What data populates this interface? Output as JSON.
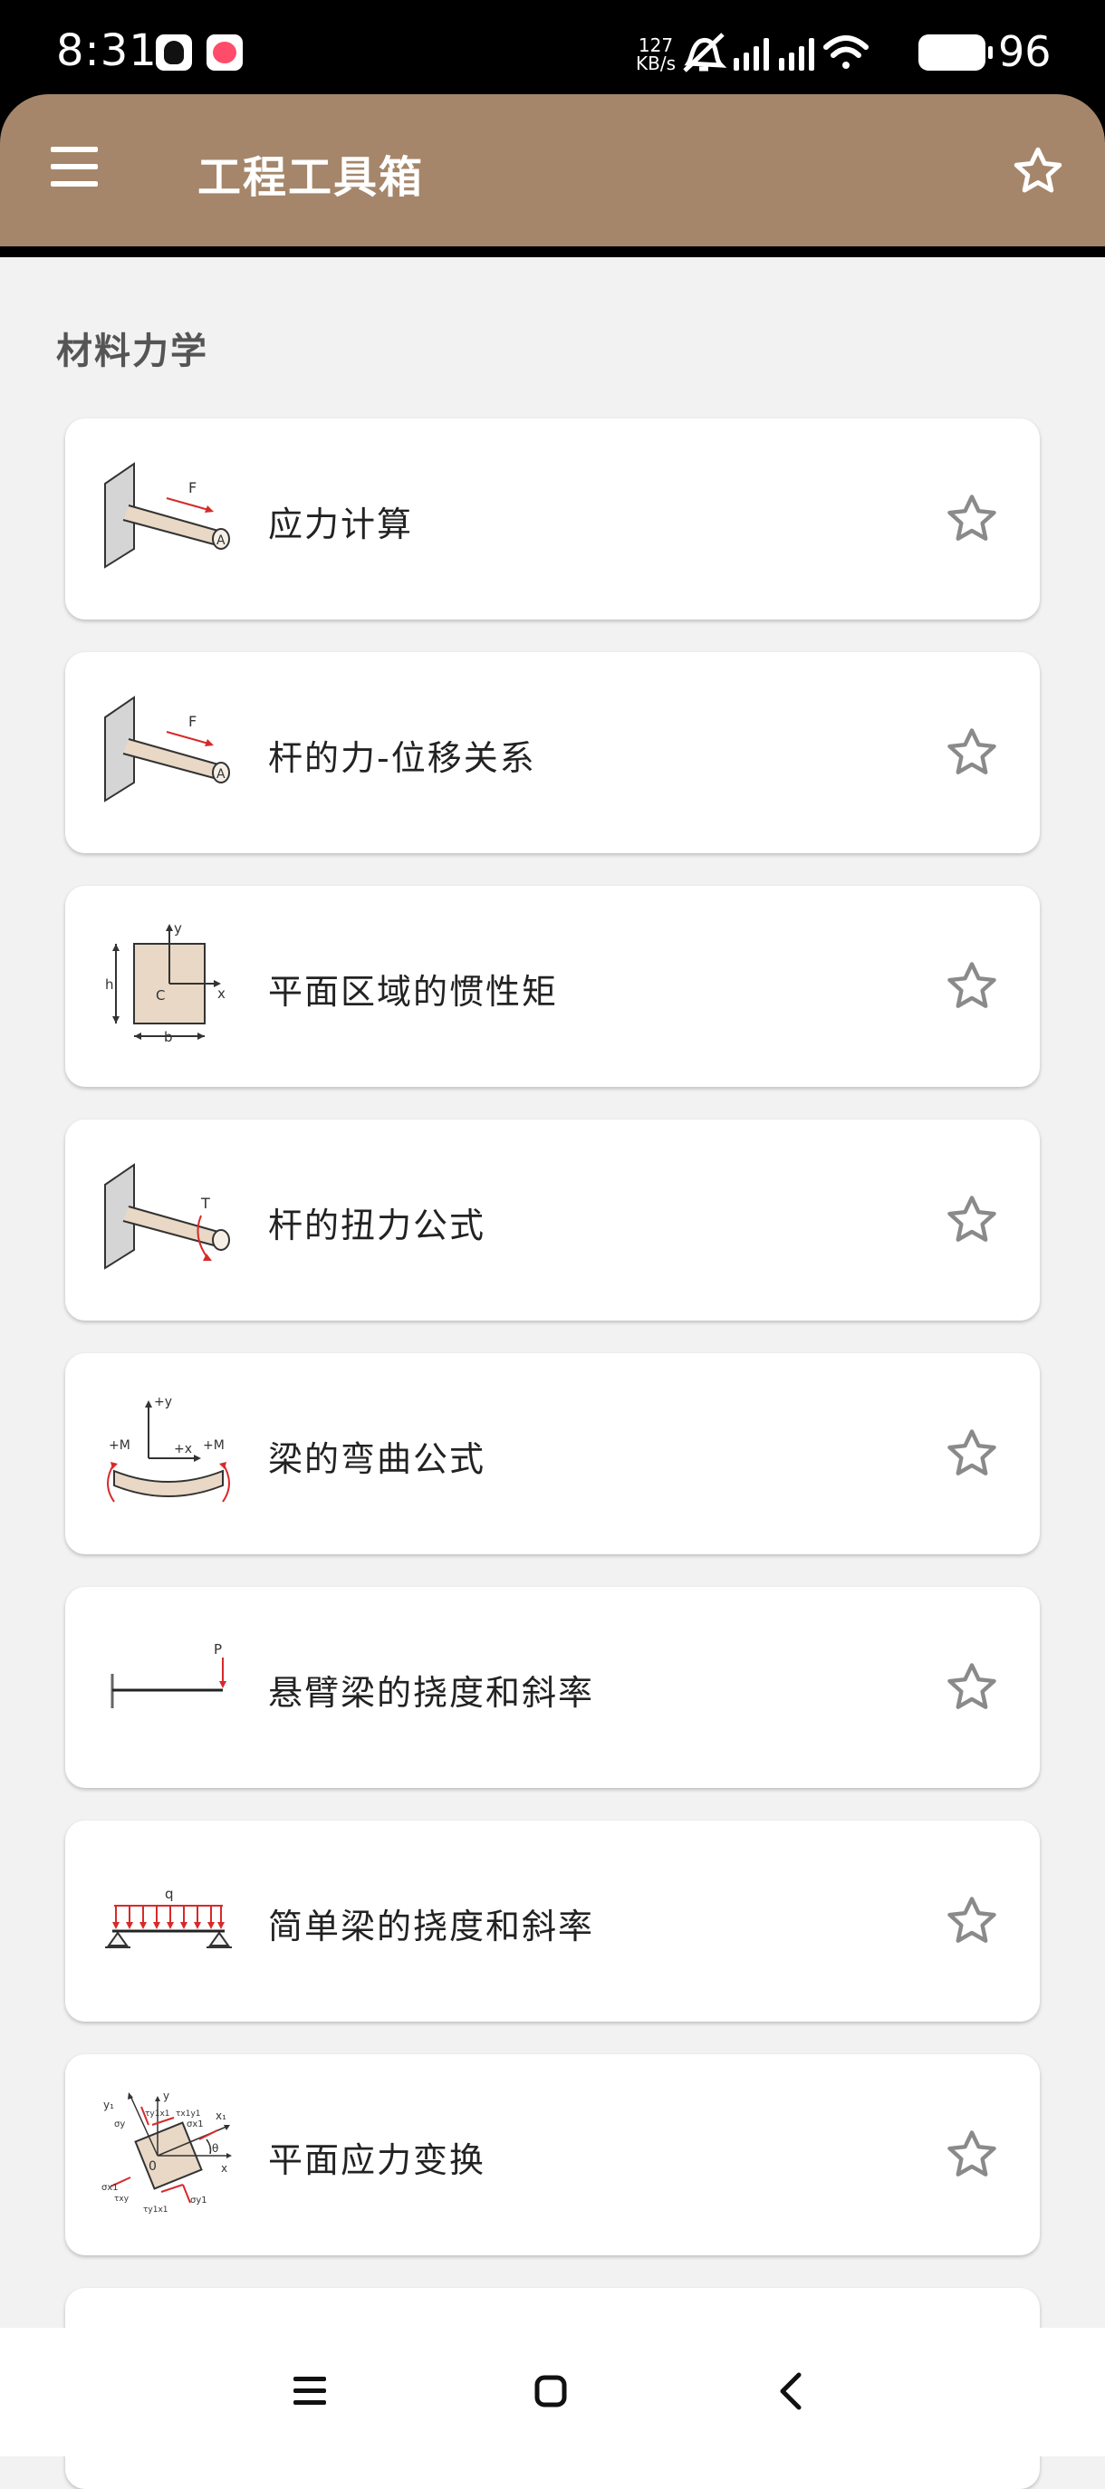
{
  "status_bar": {
    "time": "8:31",
    "net_speed": "127",
    "net_speed_unit": "KB/s",
    "battery_percent": "96"
  },
  "app_bar": {
    "title": "工程工具箱",
    "menu_icon": "hamburger-menu-icon",
    "favorite_icon": "star-outline-icon"
  },
  "section": {
    "title": "材料力学"
  },
  "items": [
    {
      "title": "应力计算",
      "icon": "cantilever-rod-axial-force-icon"
    },
    {
      "title": "杆的力-位移关系",
      "icon": "cantilever-rod-axial-force-icon"
    },
    {
      "title": "平面区域的惯性矩",
      "icon": "rectangle-section-inertia-icon"
    },
    {
      "title": "杆的扭力公式",
      "icon": "cantilever-rod-torque-icon"
    },
    {
      "title": "梁的弯曲公式",
      "icon": "beam-bending-icon"
    },
    {
      "title": "悬臂梁的挠度和斜率",
      "icon": "cantilever-beam-point-load-icon"
    },
    {
      "title": "简单梁的挠度和斜率",
      "icon": "simply-supported-beam-distributed-load-icon"
    },
    {
      "title": "平面应力变换",
      "icon": "plane-stress-element-icon"
    }
  ],
  "diagram_labels": {
    "force": "F",
    "area": "A",
    "y": "y",
    "x": "x",
    "h": "h",
    "b": "b",
    "c": "C",
    "torque": "T",
    "plus_y": "+y",
    "plus_x": "+x",
    "plus_m": "+M",
    "load_p": "P",
    "load_q": "q",
    "origin": "0",
    "x1": "x₁",
    "y1": "y₁",
    "theta": "θ",
    "sigma_x": "σx",
    "sigma_y": "σy",
    "sigma_x1": "σx1",
    "sigma_y1": "σy1",
    "tau_xy": "τxy",
    "tau_x1y1": "τx1y1",
    "tau_y1x1": "τy1x1"
  },
  "nav_bar": {
    "recents_icon": "recents-icon",
    "home_icon": "home-icon",
    "back_icon": "back-icon"
  },
  "colors": {
    "app_bar": "#a5866a",
    "background": "#f2f2f2",
    "card": "#ffffff",
    "accent_arrow": "#d62a2a",
    "rod_fill": "#e8d8c5"
  }
}
